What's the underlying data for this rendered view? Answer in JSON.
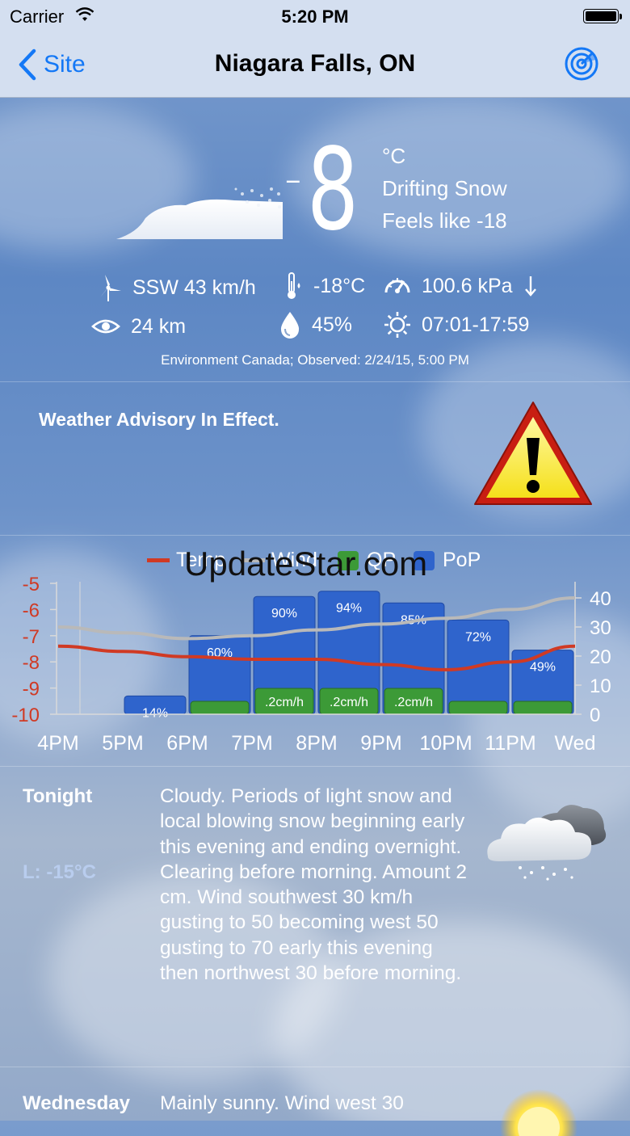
{
  "status_bar": {
    "carrier": "Carrier",
    "time": "5:20 PM"
  },
  "nav": {
    "back_label": "Site",
    "title": "Niagara Falls, ON"
  },
  "current": {
    "temp_sign": "-",
    "temp_value": "8",
    "unit": "°C",
    "condition": "Drifting Snow",
    "feels_like": "Feels like -18",
    "wind": "SSW 43 km/h",
    "dewpoint": "-18°C",
    "pressure": "100.6 kPa",
    "visibility": "24 km",
    "humidity": "45%",
    "sun": "07:01-17:59",
    "observed": "Environment Canada; Observed: 2/24/15, 5:00 PM"
  },
  "advisory": {
    "text": "Weather Advisory In Effect."
  },
  "watermark": "UpdateStar.com",
  "chart_data": {
    "type": "bar",
    "legend": [
      "Temp",
      "Wind",
      "QP",
      "PoP"
    ],
    "categories": [
      "4PM",
      "5PM",
      "6PM",
      "7PM",
      "8PM",
      "9PM",
      "10PM",
      "11PM",
      "Wed"
    ],
    "series": [
      {
        "name": "Temp",
        "type": "line",
        "color": "#d03a24",
        "x": [
          4,
          5,
          6,
          7,
          8,
          9,
          10,
          11,
          12
        ],
        "values": [
          -7.4,
          -7.6,
          -7.8,
          -7.9,
          -7.9,
          -8.1,
          -8.3,
          -8.0,
          -7.4
        ]
      },
      {
        "name": "Wind",
        "type": "line",
        "color": "#b9b9b9",
        "x": [
          4,
          5,
          6,
          7,
          8,
          9,
          10,
          11,
          12
        ],
        "values": [
          30,
          28,
          26,
          27,
          29,
          31,
          33,
          36,
          40
        ]
      },
      {
        "name": "PoP",
        "type": "bar",
        "color": "#2f64cc",
        "bars": [
          {
            "x": 5.5,
            "value": 14,
            "label": "14%"
          },
          {
            "x": 6.5,
            "value": 60,
            "label": "60%"
          },
          {
            "x": 7.5,
            "value": 90,
            "label": "90%"
          },
          {
            "x": 8.5,
            "value": 94,
            "label": "94%"
          },
          {
            "x": 9.5,
            "value": 85,
            "label": "85%"
          },
          {
            "x": 10.5,
            "value": 72,
            "label": "72%"
          },
          {
            "x": 11.5,
            "value": 49,
            "label": "49%"
          }
        ]
      },
      {
        "name": "QP",
        "type": "bar",
        "color": "#3c9a37",
        "bars": [
          {
            "x": 6.5,
            "value": 0.1,
            "label": ""
          },
          {
            "x": 7.5,
            "value": 0.2,
            "label": ".2cm/h"
          },
          {
            "x": 8.5,
            "value": 0.2,
            "label": ".2cm/h"
          },
          {
            "x": 9.5,
            "value": 0.2,
            "label": ".2cm/h"
          },
          {
            "x": 10.5,
            "value": 0.1,
            "label": ""
          },
          {
            "x": 11.5,
            "value": 0.1,
            "label": ""
          }
        ]
      }
    ],
    "left_axis": {
      "min": -10,
      "max": -5,
      "ticks": [
        "-5",
        "-6",
        "-7",
        "-8",
        "-9",
        "-10"
      ],
      "color": "#d03a24"
    },
    "right_axis": {
      "min": 0,
      "max": 45,
      "ticks": [
        "40",
        "30",
        "20",
        "10",
        "0"
      ]
    },
    "xlim": [
      4,
      12
    ],
    "grid": false,
    "legend_position": "top"
  },
  "forecast": [
    {
      "day": "Tonight",
      "low": "L: -15°C",
      "text": "Cloudy. Periods of light snow and local blowing snow beginning early this evening and ending overnight. Clearing before morning. Amount 2 cm. Wind southwest 30 km/h gusting to 50 becoming west 50 gusting to 70 early this evening then northwest 30 before morning.",
      "icon": "cloud-snow-icon"
    },
    {
      "day": "Wednesday",
      "text": "Mainly sunny. Wind west 30",
      "icon": "sun-icon"
    }
  ]
}
